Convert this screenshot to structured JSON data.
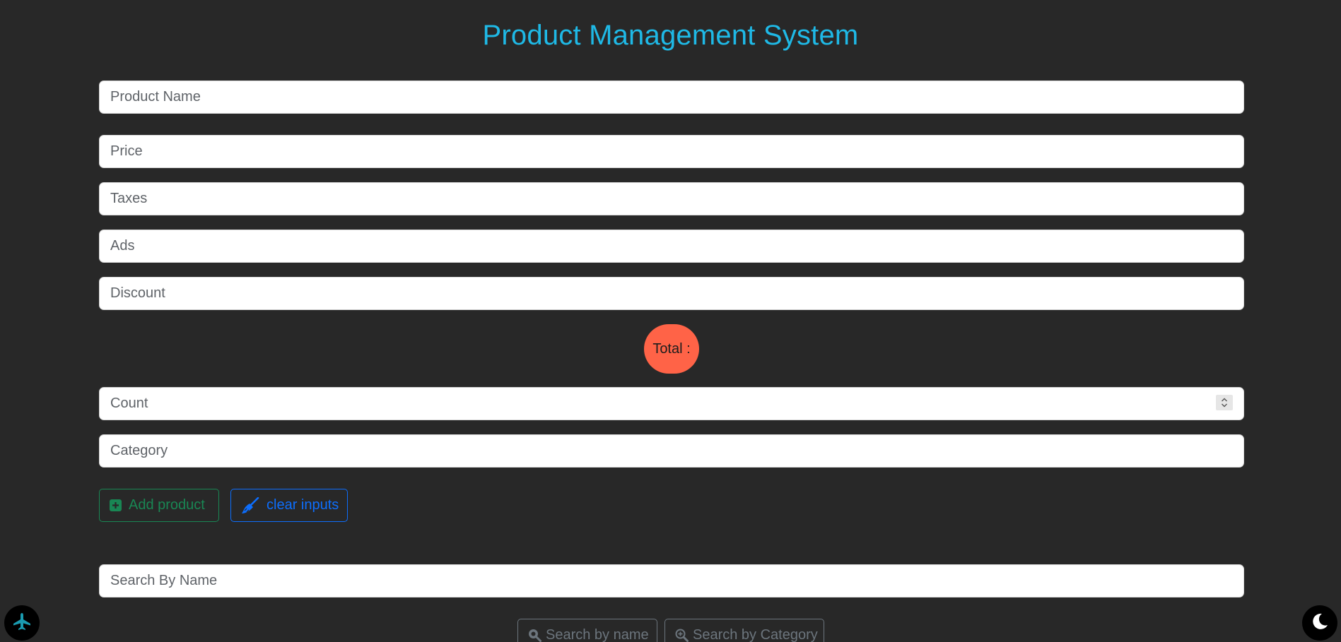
{
  "header": {
    "title": "Product Management System"
  },
  "form": {
    "product_name_placeholder": "Product Name",
    "price_placeholder": "Price",
    "taxes_placeholder": "Taxes",
    "ads_placeholder": "Ads",
    "discount_placeholder": "Discount",
    "total_label": "Total :",
    "count_placeholder": "Count",
    "category_placeholder": "Category"
  },
  "actions": {
    "add_label": "Add product",
    "clear_label": "clear inputs"
  },
  "search": {
    "placeholder": "Search By Name",
    "by_name_label": "Search by name",
    "by_category_label": "Search by Category"
  },
  "icons": {
    "add": "plus-square-icon",
    "clear": "broom-icon",
    "search_name": "search-icon",
    "search_category": "search-plus-icon",
    "scroll": "plane-icon",
    "theme": "moon-icon"
  },
  "colors": {
    "background": "#282828",
    "title": "#1fb9e6",
    "total_badge": "#ff6347",
    "add_button": "#198754",
    "clear_button": "#0d6efd",
    "search_button": "#6c757d",
    "plane_icon": "#1a9bb0"
  }
}
